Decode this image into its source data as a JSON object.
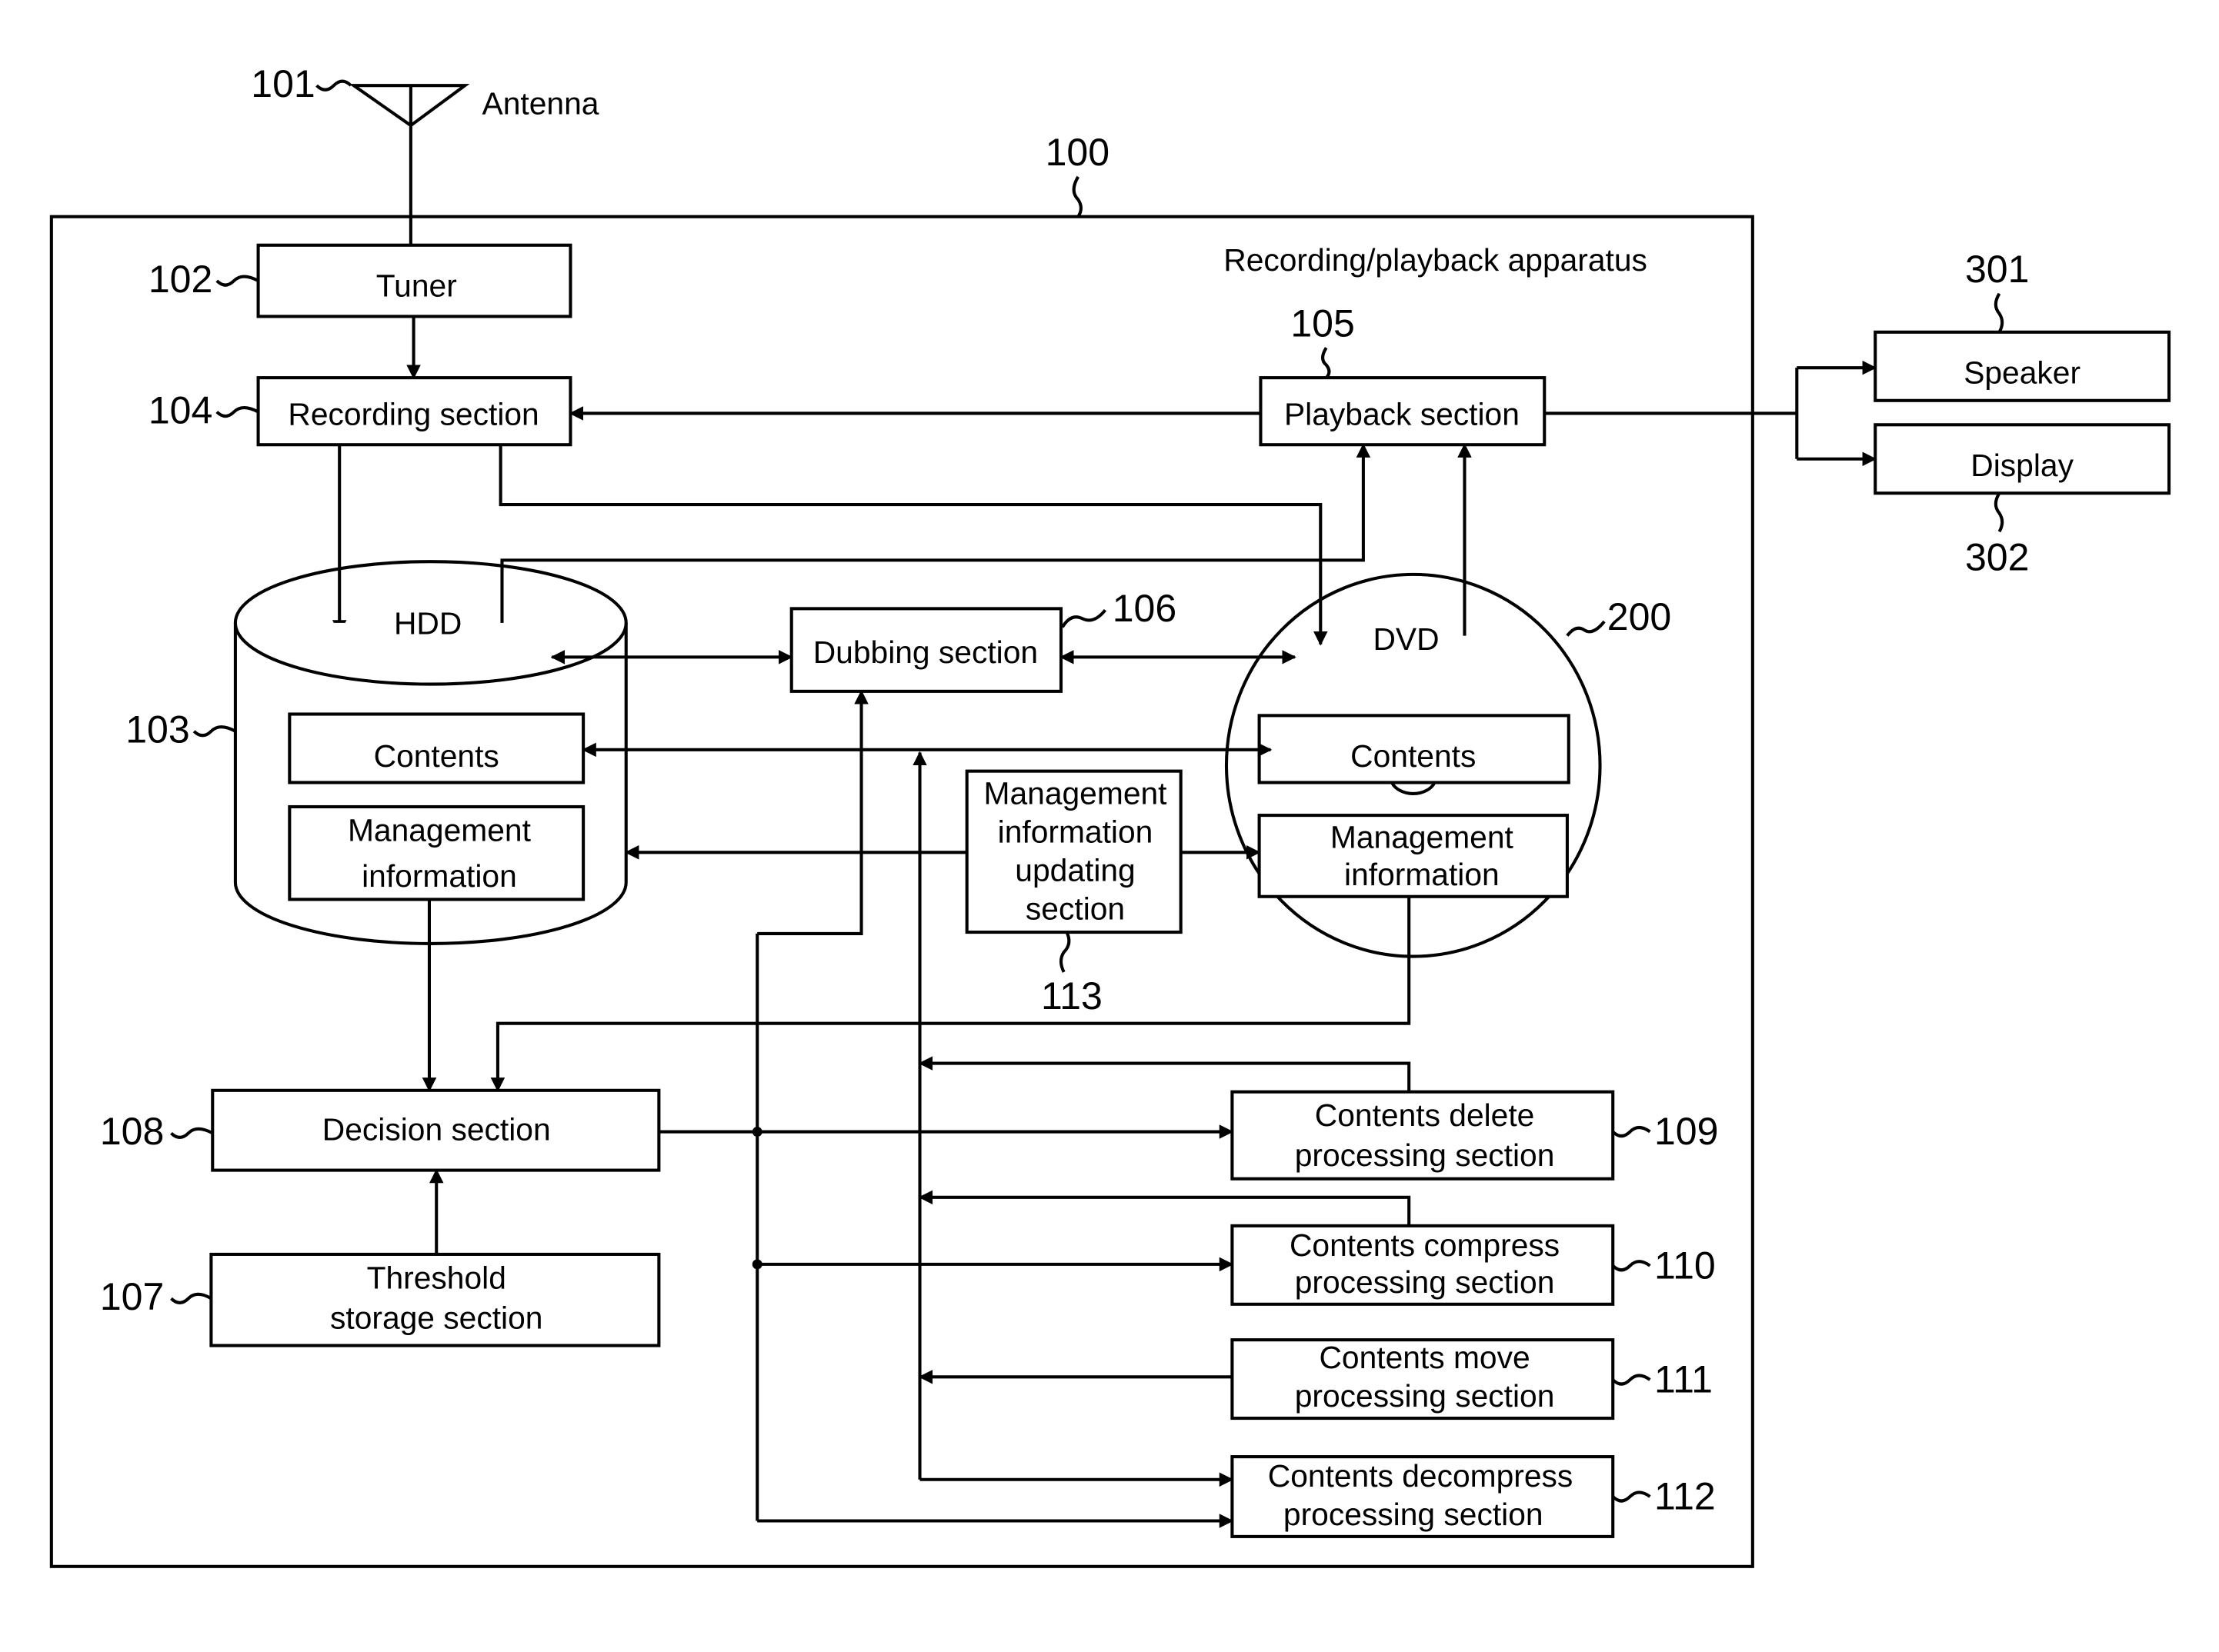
{
  "figure": {
    "apparatus_title": "Recording/playback apparatus",
    "apparatus_ref": "100",
    "antenna": {
      "ref": "101",
      "label": "Antenna"
    },
    "blocks": {
      "tuner": {
        "ref": "102",
        "lines": [
          "Tuner"
        ]
      },
      "recording": {
        "ref": "104",
        "lines": [
          "Recording section"
        ]
      },
      "playback": {
        "ref": "105",
        "lines": [
          "Playback section"
        ]
      },
      "dubbing": {
        "ref": "106",
        "lines": [
          "Dubbing section"
        ]
      },
      "threshold": {
        "ref": "107",
        "lines": [
          "Threshold",
          "storage section"
        ]
      },
      "decision": {
        "ref": "108",
        "lines": [
          "Decision section"
        ]
      },
      "delete": {
        "ref": "109",
        "lines": [
          "Contents delete",
          "processing section"
        ]
      },
      "compress": {
        "ref": "110",
        "lines": [
          "Contents compress",
          "processing section"
        ]
      },
      "move": {
        "ref": "111",
        "lines": [
          "Contents move",
          "processing section"
        ]
      },
      "decompress": {
        "ref": "112",
        "lines": [
          "Contents decompress",
          "processing section"
        ]
      },
      "mgmt_update": {
        "ref": "113",
        "lines": [
          "Management",
          "information",
          "updating",
          "section"
        ]
      },
      "speaker": {
        "ref": "301",
        "lines": [
          "Speaker"
        ]
      },
      "display": {
        "ref": "302",
        "lines": [
          "Display"
        ]
      }
    },
    "hdd": {
      "ref": "103",
      "label": "HDD",
      "contents": [
        "Contents"
      ],
      "management": [
        "Management",
        "information"
      ]
    },
    "dvd": {
      "ref": "200",
      "label": "DVD",
      "contents": [
        "Contents"
      ],
      "management": [
        "Management",
        "information"
      ]
    }
  }
}
